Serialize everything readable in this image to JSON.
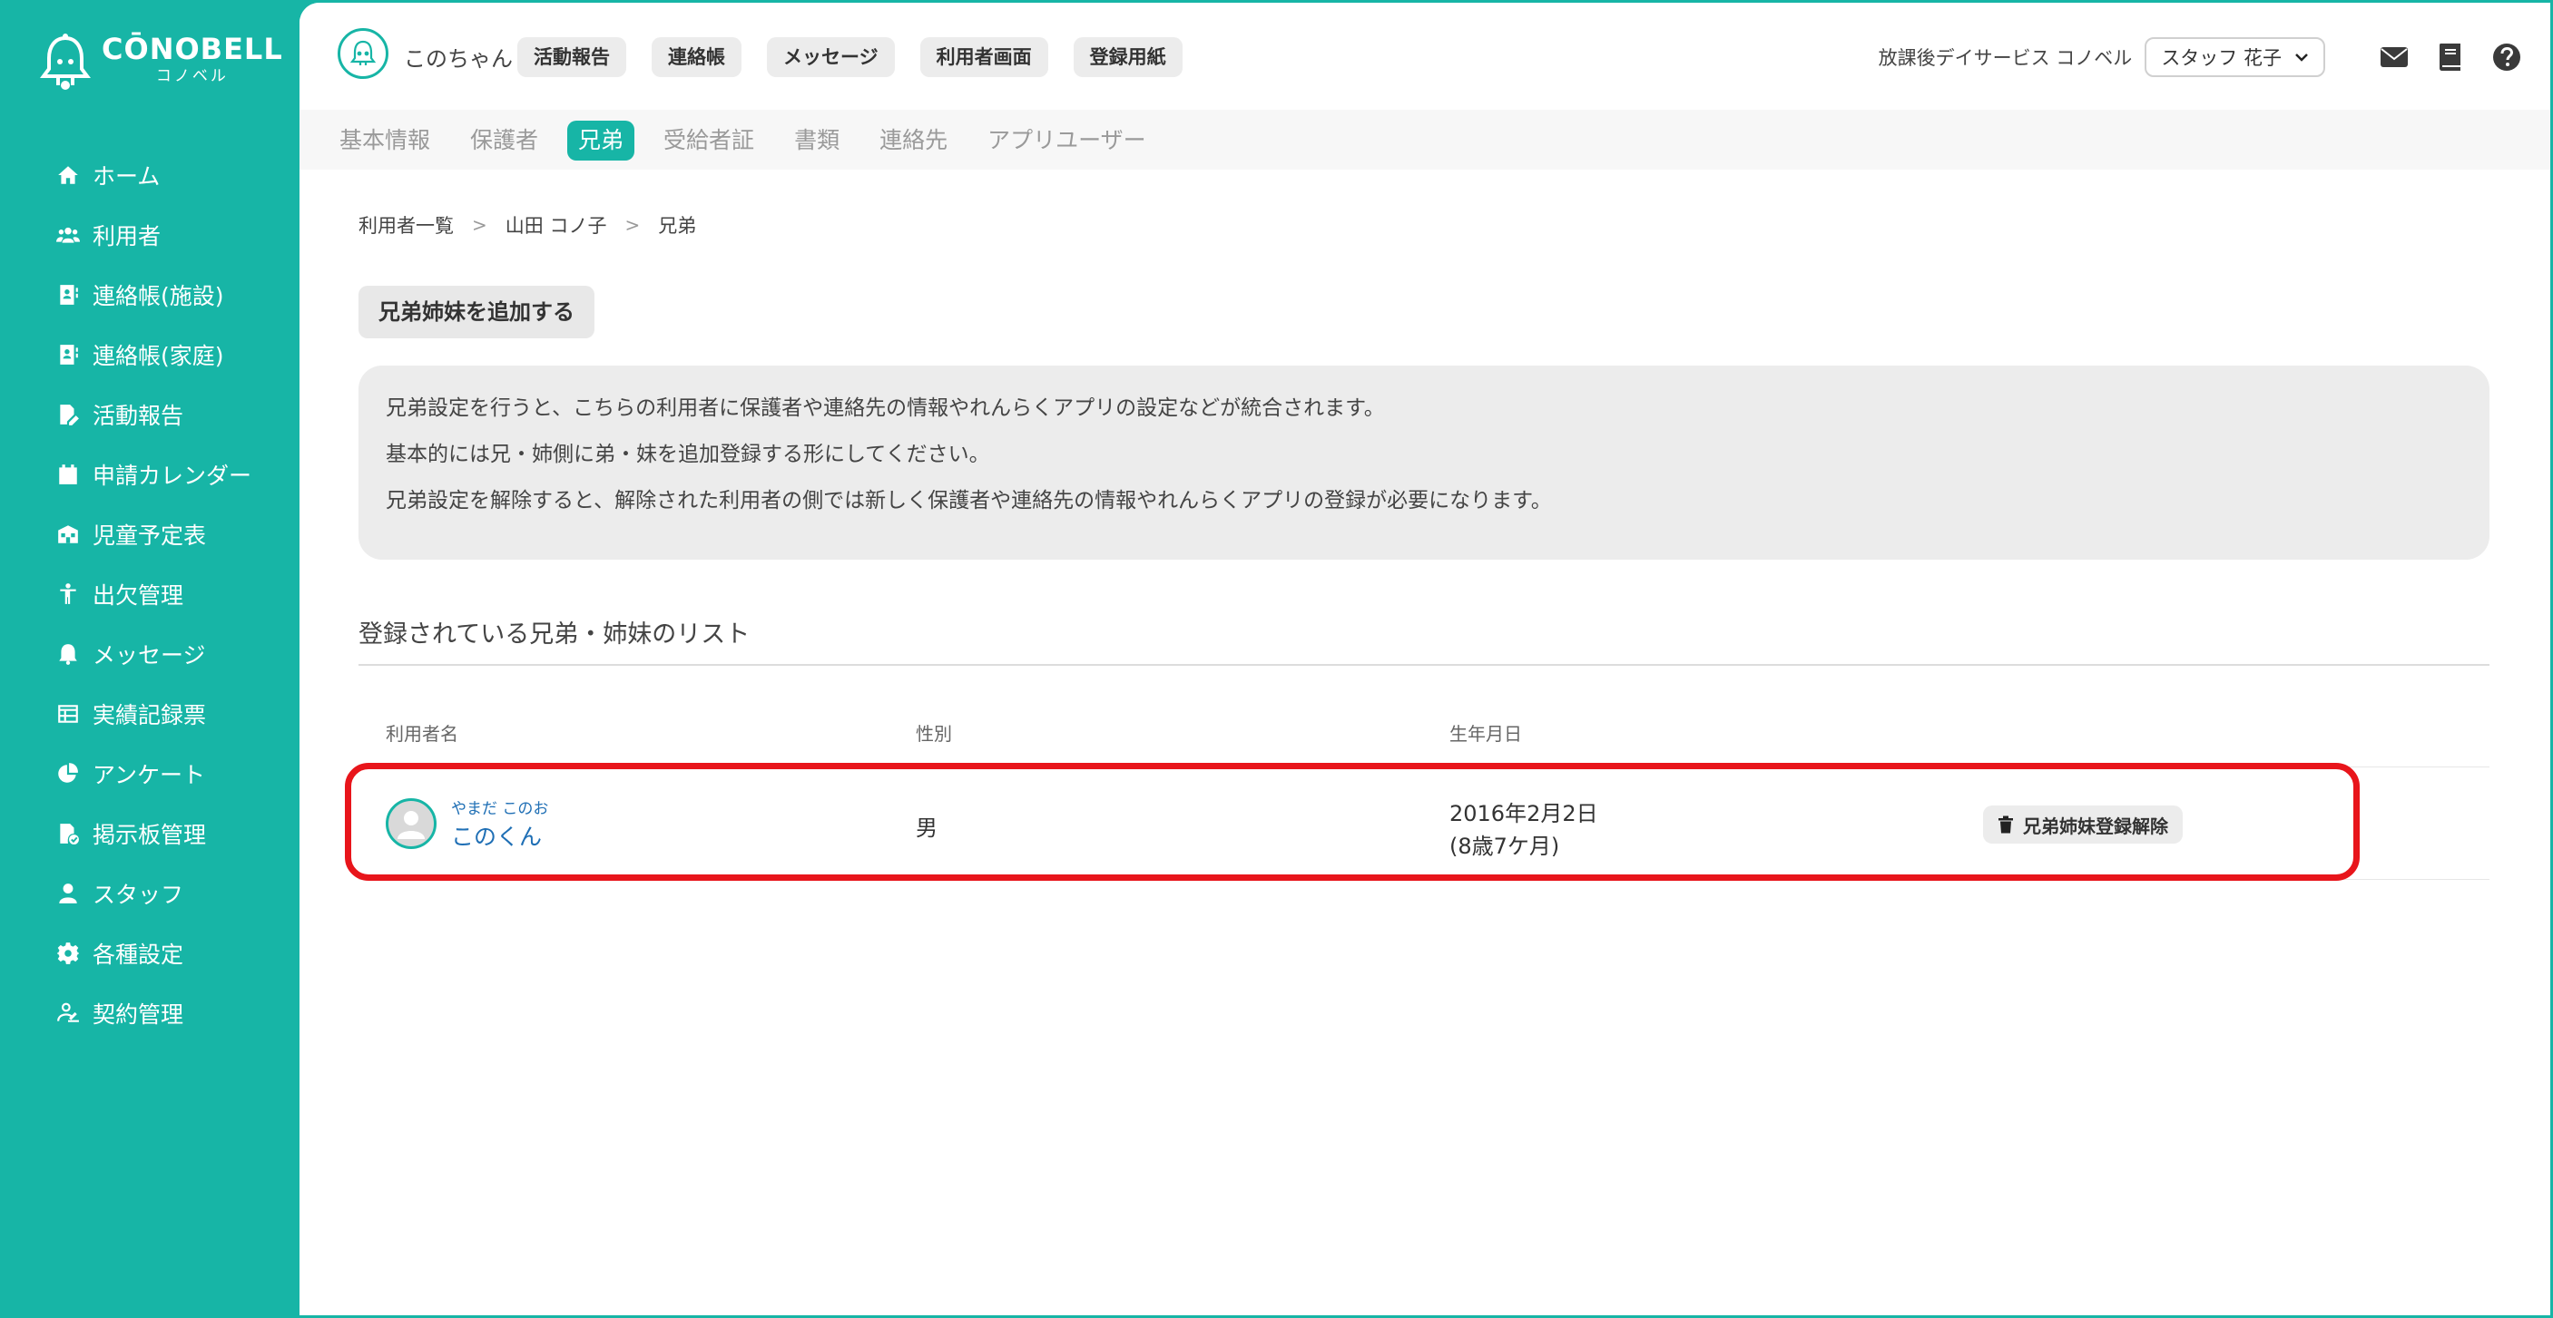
{
  "sidebar": {
    "logo_main": "CŌNOBELL",
    "logo_sub": "コノベル",
    "items": [
      {
        "label": "ホーム",
        "icon": "home-icon"
      },
      {
        "label": "利用者",
        "icon": "users-icon"
      },
      {
        "label": "連絡帳(施設)",
        "icon": "contact-book-icon"
      },
      {
        "label": "連絡帳(家庭)",
        "icon": "contact-book-icon"
      },
      {
        "label": "活動報告",
        "icon": "report-edit-icon"
      },
      {
        "label": "申請カレンダー",
        "icon": "calendar-icon"
      },
      {
        "label": "児童予定表",
        "icon": "schedule-icon"
      },
      {
        "label": "出欠管理",
        "icon": "attendance-icon"
      },
      {
        "label": "メッセージ",
        "icon": "bell-icon"
      },
      {
        "label": "実績記録票",
        "icon": "table-icon"
      },
      {
        "label": "アンケート",
        "icon": "pie-chart-icon"
      },
      {
        "label": "掲示板管理",
        "icon": "board-check-icon"
      },
      {
        "label": "スタッフ",
        "icon": "staff-icon"
      },
      {
        "label": "各種設定",
        "icon": "gear-icon"
      },
      {
        "label": "契約管理",
        "icon": "contract-icon"
      }
    ]
  },
  "topbar": {
    "child_name": "このちゃん",
    "pills": [
      "活動報告",
      "連絡帳",
      "メッセージ",
      "利用者画面",
      "登録用紙"
    ],
    "facility": "放課後デイサービス コノベル",
    "staff_selected": "スタッフ 花子"
  },
  "tabs": [
    {
      "label": "基本情報",
      "active": false
    },
    {
      "label": "保護者",
      "active": false
    },
    {
      "label": "兄弟",
      "active": true
    },
    {
      "label": "受給者証",
      "active": false
    },
    {
      "label": "書類",
      "active": false
    },
    {
      "label": "連絡先",
      "active": false
    },
    {
      "label": "アプリユーザー",
      "active": false
    }
  ],
  "breadcrumb": [
    "利用者一覧",
    "山田 コノ子",
    "兄弟"
  ],
  "add_button": "兄弟姉妹を追加する",
  "info_lines": [
    "兄弟設定を行うと、こちらの利用者に保護者や連絡先の情報やれんらくアプリの設定などが統合されます。",
    "基本的には兄・姉側に弟・妹を追加登録する形にしてください。",
    "兄弟設定を解除すると、解除された利用者の側では新しく保護者や連絡先の情報やれんらくアプリの登録が必要になります。"
  ],
  "section_title": "登録されている兄弟・姉妹のリスト",
  "table": {
    "headers": [
      "利用者名",
      "性別",
      "生年月日"
    ],
    "rows": [
      {
        "furigana": "やまだ このお",
        "name": "このくん",
        "gender": "男",
        "dob": "2016年2月2日",
        "age": "(8歳7ケ月)",
        "action": "兄弟姉妹登録解除"
      }
    ]
  },
  "colors": {
    "accent": "#17b5a6",
    "highlight": "#e8151b",
    "link": "#1f6fb5"
  }
}
